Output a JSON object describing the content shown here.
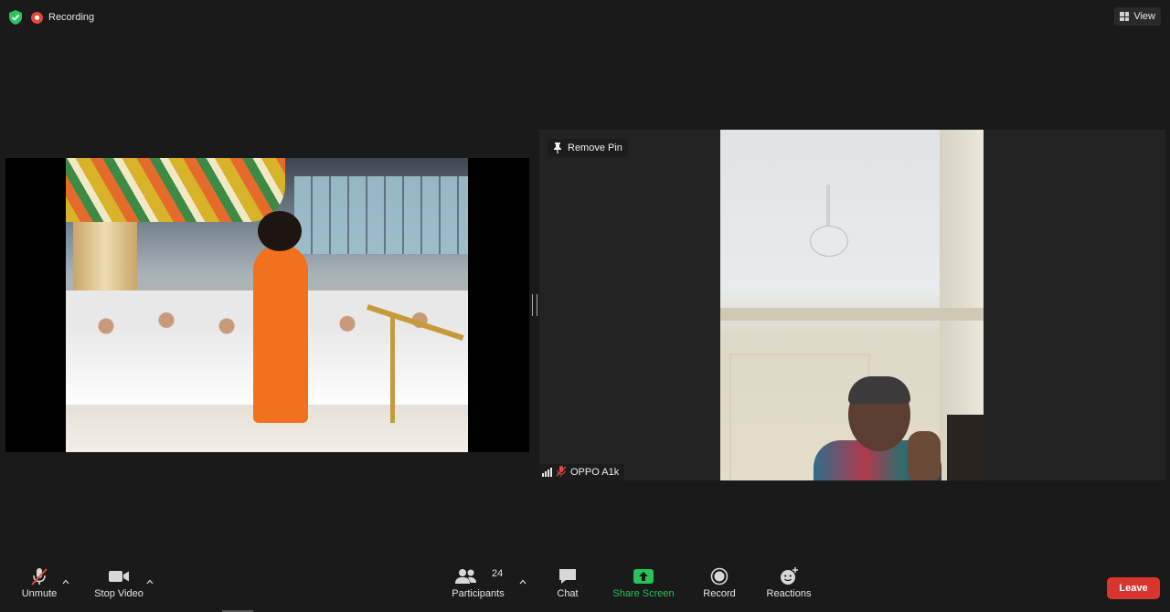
{
  "top_bar": {
    "recording_label": "Recording",
    "view_label": "View"
  },
  "videos": {
    "pinned": {
      "remove_pin_label": "Remove Pin",
      "participant_name": "OPPO A1k"
    }
  },
  "toolbar": {
    "unmute_label": "Unmute",
    "stop_video_label": "Stop Video",
    "participants_label": "Participants",
    "participants_count": "24",
    "chat_label": "Chat",
    "share_screen_label": "Share Screen",
    "record_label": "Record",
    "reactions_label": "Reactions",
    "leave_label": "Leave"
  },
  "colors": {
    "background": "#1a1a1a",
    "leave": "#d8352e",
    "share_screen": "#29c15a",
    "recording_dot": "#e0483e",
    "shield": "#2ec25c"
  }
}
